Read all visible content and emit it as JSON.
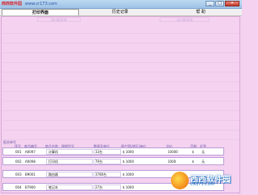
{
  "watermark": {
    "brand": "西西软件园",
    "url": "www.cr173.com"
  },
  "window_controls": [
    "_",
    "□",
    "✕"
  ],
  "tabs": [
    {
      "label": "打印界面",
      "active": true
    },
    {
      "label": "历史记录",
      "active": false
    },
    {
      "label": "帮  助",
      "active": false
    }
  ],
  "toolbar": {
    "left_button": "进口报关单",
    "right_button": "出口报关单"
  },
  "grid_caption": "报关单号",
  "table": {
    "columns": [
      "序号",
      "商品编号",
      "商品名称、规格型号",
      "数量及单位",
      "原产国(地区)单价",
      "总价",
      "币制",
      "征免"
    ],
    "rows": [
      [
        "001",
        "A0097",
        "计算机",
        "33台",
        "$ 1000",
        "10000",
        "$",
        "无"
      ],
      [
        "002",
        "A0098",
        "打印机",
        "79台",
        "$ 1000",
        "1000",
        "$",
        "无"
      ],
      [
        "003",
        "B9001",
        "路由器",
        "3780台",
        "$ 1000",
        "",
        "",
        ""
      ],
      [
        "004",
        "B7900",
        "笔记本",
        "27台",
        "$ 1000",
        "",
        "",
        ""
      ]
    ]
  },
  "bottom_watermark": {
    "cn": "西西软件园",
    "en": "CR173.COM"
  },
  "colors": {
    "background": "#f4d2f0",
    "text": "#6b5aa8",
    "title_brand": "#d8232a"
  }
}
